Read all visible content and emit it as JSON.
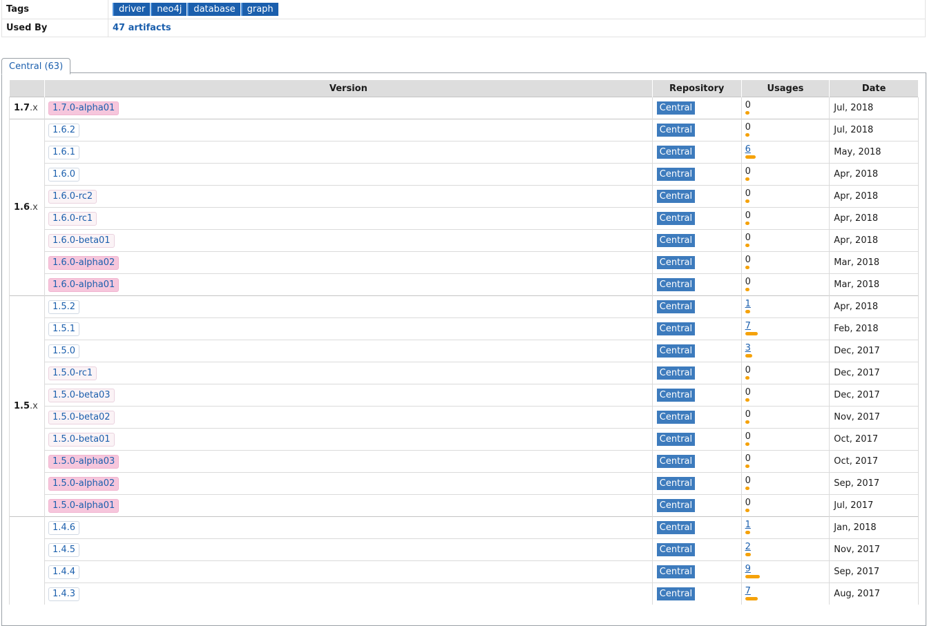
{
  "info": {
    "tags_label": "Tags",
    "tags": [
      "driver",
      "neo4j",
      "database",
      "graph"
    ],
    "used_by_label": "Used By",
    "used_by_value": "47 artifacts"
  },
  "tab": {
    "label": "Central (63)"
  },
  "table": {
    "headers": {
      "version": "Version",
      "repository": "Repository",
      "usages": "Usages",
      "date": "Date"
    },
    "groups": [
      {
        "major": "1.7",
        "suffix": ".x",
        "rows": [
          {
            "version": "1.7.0-alpha01",
            "kind": "alpha",
            "repo": "Central",
            "usages": "0",
            "usage_fraction": 0.2,
            "date": "Jul, 2018"
          }
        ]
      },
      {
        "major": "1.6",
        "suffix": ".x",
        "rows": [
          {
            "version": "1.6.2",
            "kind": "release",
            "repo": "Central",
            "usages": "0",
            "usage_fraction": 0.2,
            "date": "Jul, 2018"
          },
          {
            "version": "1.6.1",
            "kind": "release",
            "repo": "Central",
            "usages": "6",
            "usage_fraction": 0.55,
            "date": "May, 2018"
          },
          {
            "version": "1.6.0",
            "kind": "release",
            "repo": "Central",
            "usages": "0",
            "usage_fraction": 0.2,
            "date": "Apr, 2018"
          },
          {
            "version": "1.6.0-rc2",
            "kind": "rc",
            "repo": "Central",
            "usages": "0",
            "usage_fraction": 0.2,
            "date": "Apr, 2018"
          },
          {
            "version": "1.6.0-rc1",
            "kind": "rc",
            "repo": "Central",
            "usages": "0",
            "usage_fraction": 0.2,
            "date": "Apr, 2018"
          },
          {
            "version": "1.6.0-beta01",
            "kind": "beta",
            "repo": "Central",
            "usages": "0",
            "usage_fraction": 0.2,
            "date": "Apr, 2018"
          },
          {
            "version": "1.6.0-alpha02",
            "kind": "alpha",
            "repo": "Central",
            "usages": "0",
            "usage_fraction": 0.2,
            "date": "Mar, 2018"
          },
          {
            "version": "1.6.0-alpha01",
            "kind": "alpha",
            "repo": "Central",
            "usages": "0",
            "usage_fraction": 0.2,
            "date": "Mar, 2018"
          }
        ]
      },
      {
        "major": "1.5",
        "suffix": ".x",
        "rows": [
          {
            "version": "1.5.2",
            "kind": "release",
            "repo": "Central",
            "usages": "1",
            "usage_fraction": 0.25,
            "date": "Apr, 2018"
          },
          {
            "version": "1.5.1",
            "kind": "release",
            "repo": "Central",
            "usages": "7",
            "usage_fraction": 0.65,
            "date": "Feb, 2018"
          },
          {
            "version": "1.5.0",
            "kind": "release",
            "repo": "Central",
            "usages": "3",
            "usage_fraction": 0.35,
            "date": "Dec, 2017"
          },
          {
            "version": "1.5.0-rc1",
            "kind": "rc",
            "repo": "Central",
            "usages": "0",
            "usage_fraction": 0.2,
            "date": "Dec, 2017"
          },
          {
            "version": "1.5.0-beta03",
            "kind": "beta",
            "repo": "Central",
            "usages": "0",
            "usage_fraction": 0.2,
            "date": "Dec, 2017"
          },
          {
            "version": "1.5.0-beta02",
            "kind": "beta",
            "repo": "Central",
            "usages": "0",
            "usage_fraction": 0.2,
            "date": "Nov, 2017"
          },
          {
            "version": "1.5.0-beta01",
            "kind": "beta",
            "repo": "Central",
            "usages": "0",
            "usage_fraction": 0.2,
            "date": "Oct, 2017"
          },
          {
            "version": "1.5.0-alpha03",
            "kind": "alpha",
            "repo": "Central",
            "usages": "0",
            "usage_fraction": 0.2,
            "date": "Oct, 2017"
          },
          {
            "version": "1.5.0-alpha02",
            "kind": "alpha",
            "repo": "Central",
            "usages": "0",
            "usage_fraction": 0.2,
            "date": "Sep, 2017"
          },
          {
            "version": "1.5.0-alpha01",
            "kind": "alpha",
            "repo": "Central",
            "usages": "0",
            "usage_fraction": 0.2,
            "date": "Jul, 2017"
          }
        ]
      },
      {
        "major": "",
        "suffix": "",
        "rows": [
          {
            "version": "1.4.6",
            "kind": "release",
            "repo": "Central",
            "usages": "1",
            "usage_fraction": 0.25,
            "date": "Jan, 2018"
          },
          {
            "version": "1.4.5",
            "kind": "release",
            "repo": "Central",
            "usages": "2",
            "usage_fraction": 0.3,
            "date": "Nov, 2017"
          },
          {
            "version": "1.4.4",
            "kind": "release",
            "repo": "Central",
            "usages": "9",
            "usage_fraction": 0.75,
            "date": "Sep, 2017"
          },
          {
            "version": "1.4.3",
            "kind": "release",
            "repo": "Central",
            "usages": "7",
            "usage_fraction": 0.65,
            "date": "Aug, 2017"
          }
        ]
      }
    ]
  },
  "colors": {
    "tag_bg": "#1b5fad",
    "repo_bg": "#3d7bbd",
    "usage_bar": "#f5a20a",
    "alpha_bg": "#f6c6dc",
    "header_bg": "#dddddd"
  }
}
